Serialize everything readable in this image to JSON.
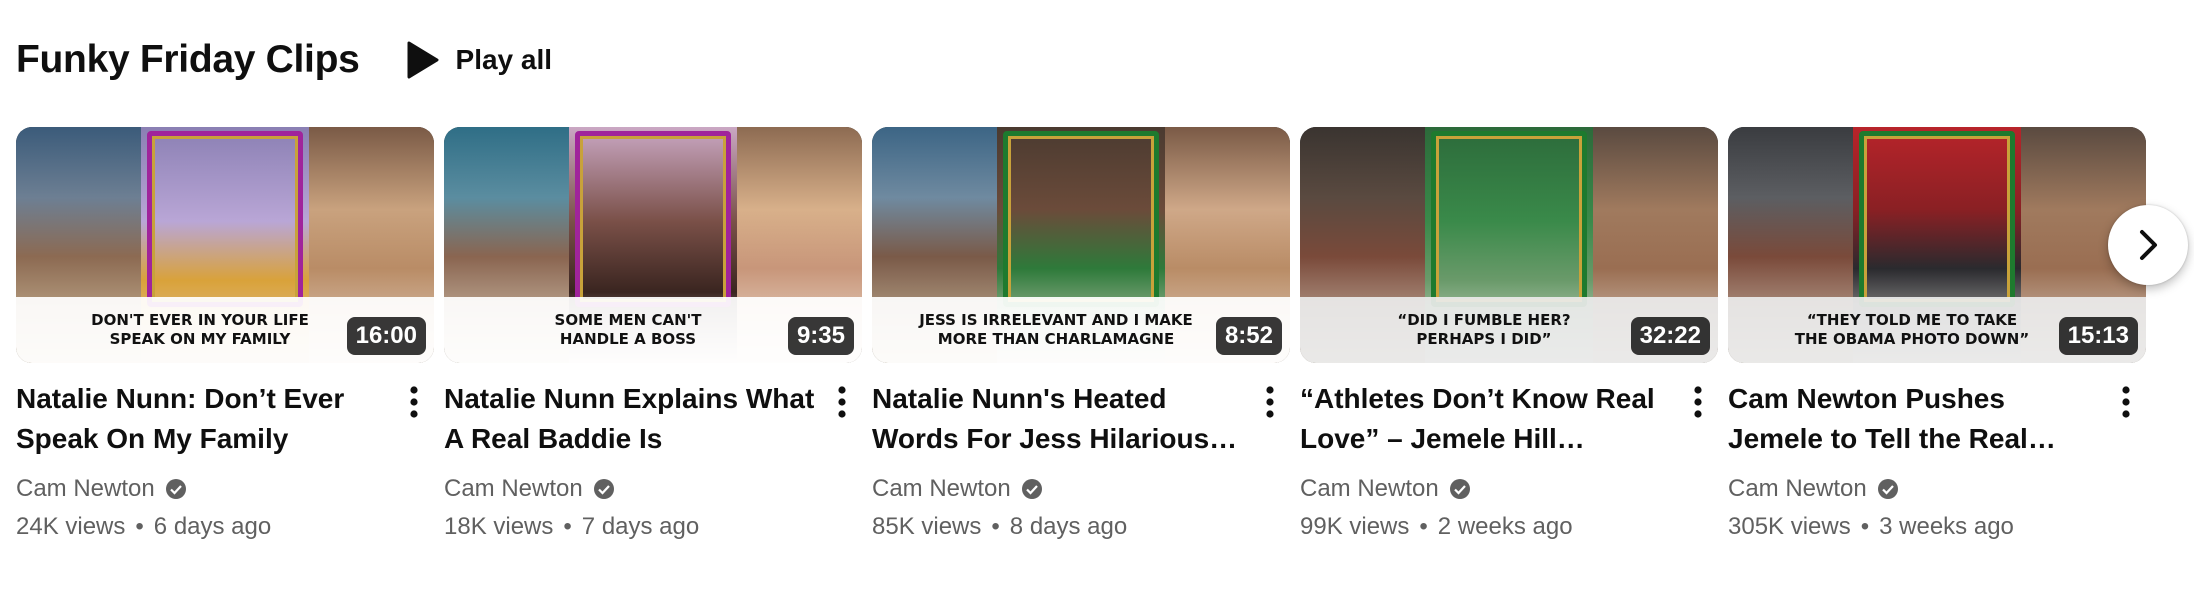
{
  "shelf": {
    "title": "Funky Friday Clips",
    "play_all_label": "Play all"
  },
  "videos": [
    {
      "title": "Natalie Nunn: Don’t Ever Speak On My Family",
      "caption": "DON'T EVER IN YOUR LIFE\nSPEAK ON MY FAMILY",
      "duration": "16:00",
      "channel": "Cam Newton",
      "views": "24K views",
      "age": "6 days ago"
    },
    {
      "title": "Natalie Nunn Explains What A Real Baddie Is",
      "caption": "SOME MEN CAN'T\nHANDLE A BOSS",
      "duration": "9:35",
      "channel": "Cam Newton",
      "views": "18K views",
      "age": "7 days ago"
    },
    {
      "title": "Natalie Nunn's Heated Words For Jess Hilarious &…",
      "caption": "JESS IS IRRELEVANT AND I MAKE\nMORE THAN CHARLAMAGNE",
      "duration": "8:52",
      "channel": "Cam Newton",
      "views": "85K views",
      "age": "8 days ago"
    },
    {
      "title": "“Athletes Don’t Know Real Love” – Jemele Hill Speaks…",
      "caption": "“DID I FUMBLE HER?\nPERHAPS I DID”",
      "duration": "32:22",
      "channel": "Cam Newton",
      "views": "99K views",
      "age": "2 weeks ago"
    },
    {
      "title": "Cam Newton Pushes Jemele to Tell the Real ESPN Story",
      "caption": "“THEY TOLD ME TO TAKE\nTHE OBAMA PHOTO DOWN”",
      "duration": "15:13",
      "channel": "Cam Newton",
      "views": "305K views",
      "age": "3 weeks ago"
    }
  ],
  "colors": {
    "text_primary": "#0f0f0f",
    "text_secondary": "#606060",
    "duration_bg": "#000000",
    "frame_green": "#1e7a2e",
    "frame_gold": "#c8a23a"
  },
  "icons": {
    "play_all": "play-icon",
    "menu": "more-vert-icon",
    "verified": "verified-check-icon",
    "next": "chevron-right-icon"
  }
}
